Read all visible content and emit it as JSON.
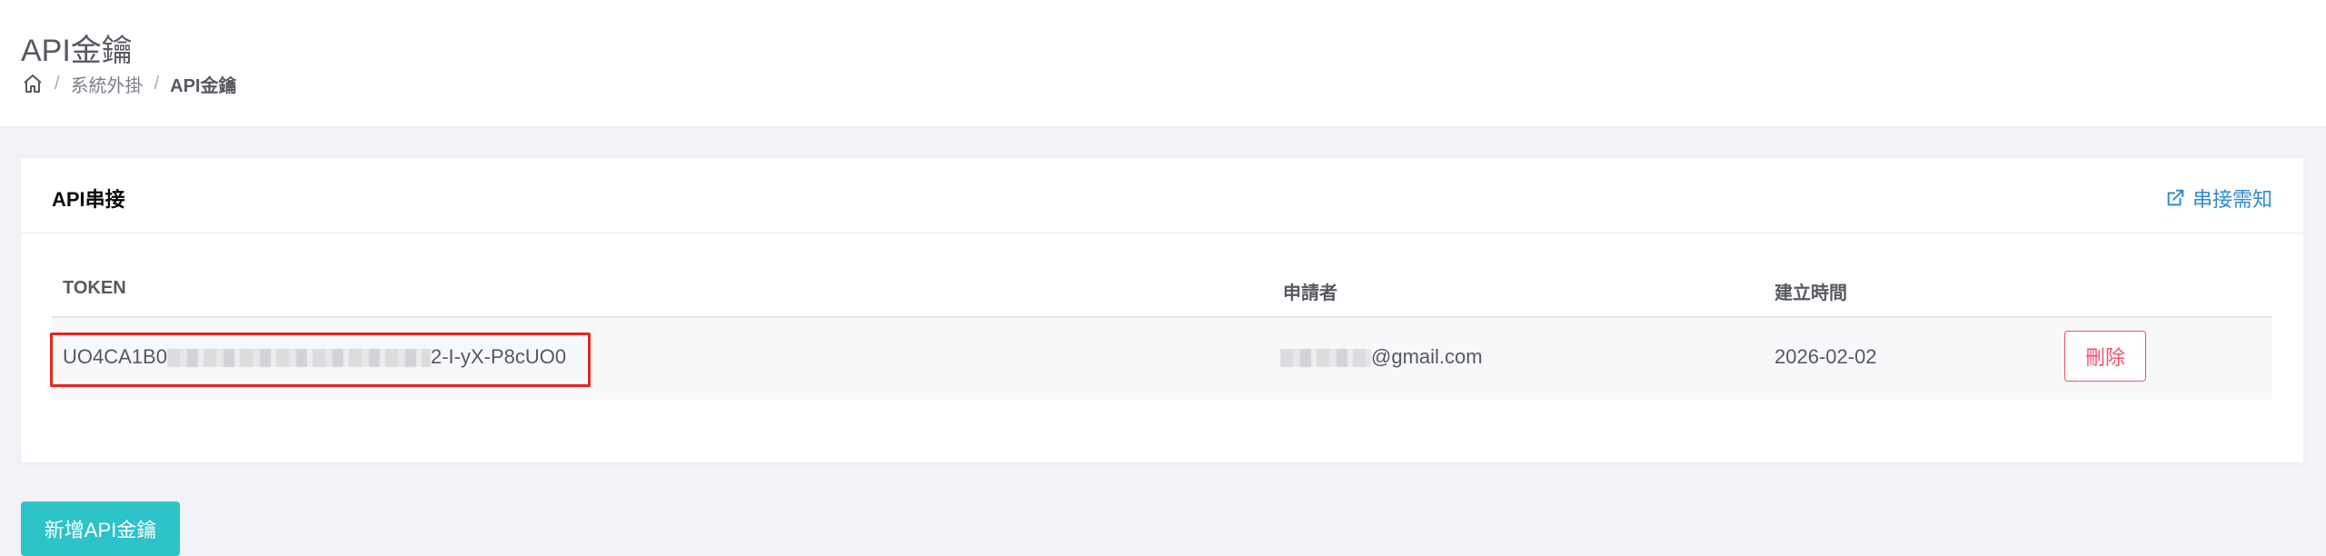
{
  "page": {
    "title": "API金鑰"
  },
  "breadcrumb": {
    "home_icon": "home-icon",
    "separator": "/",
    "items": [
      {
        "label": "系統外掛"
      },
      {
        "label": "API金鑰"
      }
    ]
  },
  "portlet": {
    "title": "API串接",
    "notice_link": {
      "label": "串接需知",
      "icon": "external-link-icon",
      "color": "#2e8bd6"
    }
  },
  "table": {
    "headers": {
      "token": "TOKEN",
      "applicant": "申請者",
      "created": "建立時間"
    },
    "rows": [
      {
        "token_prefix": "UO4CA1B0",
        "token_suffix": "2-I-yX-P8cUO0",
        "applicant_suffix": "@gmail.com",
        "created": "2026-02-02",
        "delete_label": "刪除"
      }
    ]
  },
  "add_button": {
    "label": "新增API金鑰"
  },
  "colors": {
    "highlight_border": "#e8261d",
    "delete": "#f4516c",
    "add_button": "#2cc3c9"
  }
}
